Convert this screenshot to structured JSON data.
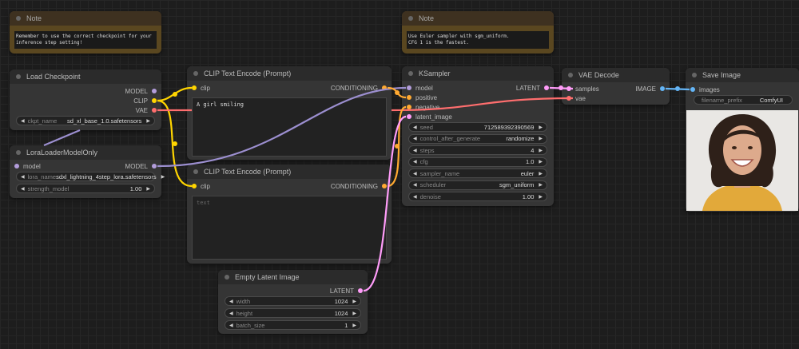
{
  "colors": {
    "model": "#b39ddb",
    "clip": "#ffd500",
    "vae": "#ff6e6e",
    "conditioning": "#ffa931",
    "latent": "#ff9cf9",
    "image": "#64b5f6"
  },
  "notes": [
    {
      "title": "Note",
      "text": "Remember to use the correct checkpoint for your\ninference step setting!"
    },
    {
      "title": "Note",
      "text": "Use Euler sampler with sgm_uniform.\nCFG 1 is the fastest."
    }
  ],
  "load_checkpoint": {
    "title": "Load Checkpoint",
    "outputs": [
      "MODEL",
      "CLIP",
      "VAE"
    ],
    "ckpt_name_label": "ckpt_name",
    "ckpt_name": "sd_xl_base_1.0.safetensors"
  },
  "lora": {
    "title": "LoraLoaderModelOnly",
    "input": "model",
    "output": "MODEL",
    "lora_name_label": "lora_name",
    "lora_name": "sdxl_lightning_4step_lora.safetensors",
    "strength_label": "strength_model",
    "strength": "1.00"
  },
  "clip1": {
    "title": "CLIP Text Encode (Prompt)",
    "input": "clip",
    "output": "CONDITIONING",
    "text": "A girl smiling"
  },
  "clip2": {
    "title": "CLIP Text Encode (Prompt)",
    "input": "clip",
    "output": "CONDITIONING",
    "placeholder": "text"
  },
  "latent": {
    "title": "Empty Latent Image",
    "output": "LATENT",
    "widgets": [
      {
        "label": "width",
        "value": "1024"
      },
      {
        "label": "height",
        "value": "1024"
      },
      {
        "label": "batch_size",
        "value": "1"
      }
    ]
  },
  "ksampler": {
    "title": "KSampler",
    "inputs": [
      "model",
      "positive",
      "negative",
      "latent_image"
    ],
    "output": "LATENT",
    "widgets": [
      {
        "label": "seed",
        "value": "712589392390569"
      },
      {
        "label": "control_after_generate",
        "value": "randomize"
      },
      {
        "label": "steps",
        "value": "4"
      },
      {
        "label": "cfg",
        "value": "1.0"
      },
      {
        "label": "sampler_name",
        "value": "euler"
      },
      {
        "label": "scheduler",
        "value": "sgm_uniform"
      },
      {
        "label": "denoise",
        "value": "1.00"
      }
    ]
  },
  "vae_decode": {
    "title": "VAE Decode",
    "inputs": [
      "samples",
      "vae"
    ],
    "output": "IMAGE"
  },
  "save_image": {
    "title": "Save Image",
    "input": "images",
    "filename_label": "filename_prefix",
    "filename": "ComfyUI"
  }
}
